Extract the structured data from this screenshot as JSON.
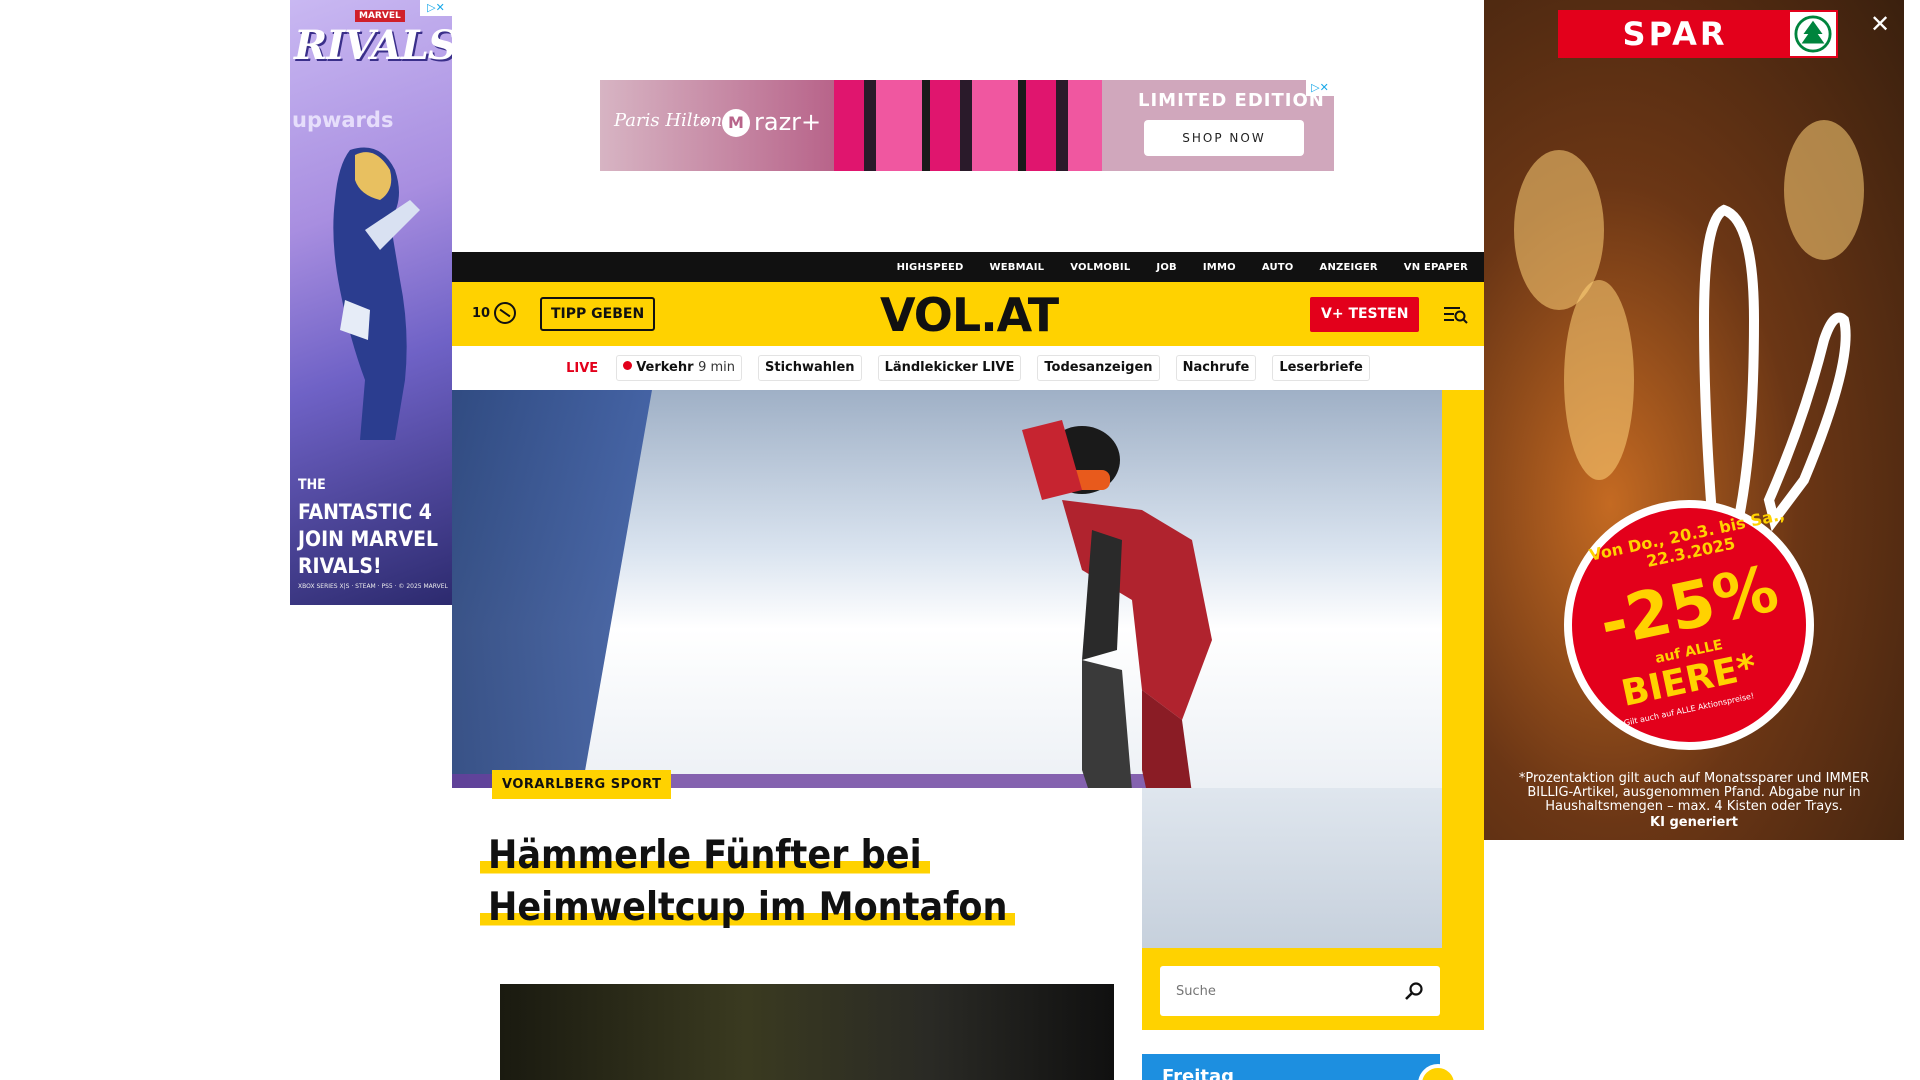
{
  "ads": {
    "left": {
      "brand": "MARVEL",
      "title": "RIVALS",
      "tag": "upwards",
      "caption_the": "THE",
      "caption_main": "FANTASTIC 4 JOIN MARVEL RIVALS!",
      "platforms": "XBOX SERIES X|S · STEAM · PS5 · © 2025 MARVEL"
    },
    "top": {
      "brand": "Paris Hilton",
      "x": "×",
      "product": "razr+",
      "headline": "LIMITED EDITION",
      "cta": "SHOP NOW"
    },
    "right": {
      "brand": "SPAR",
      "dates": "Von Do., 20.3. bis Sa., 22.3.2025",
      "discount": "-25%",
      "auf": "auf ALLE",
      "product": "BIERE*",
      "note": "Gilt auch auf ALLE Aktionspreise!",
      "fineprint": "*Prozentaktion gilt auch auf Monatssparer und IMMER BILLIG-Artikel, ausgenommen Pfand. Abgabe nur in Haushaltsmengen – max. 4 Kisten oder Trays.",
      "ki": "KI generiert",
      "close": "✕"
    }
  },
  "site": {
    "topbar": [
      "HIGHSPEED",
      "WEBMAIL",
      "VOLMOBIL",
      "JOB",
      "IMMO",
      "AUTO",
      "ANZEIGER",
      "VN EPAPER"
    ],
    "weather_temp": "10",
    "tipp_label": "TIPP GEBEN",
    "logo": "VOL.AT",
    "vplus_label": "V+ TESTEN",
    "live_label": "LIVE",
    "live_item": "Verkehr",
    "live_minutes": "9 min",
    "quicknav": [
      "Stichwahlen",
      "Ländlekicker LIVE",
      "Todesanzeigen",
      "Nachrufe",
      "Leserbriefe"
    ],
    "article": {
      "category": "VORARLBERG SPORT",
      "headline_line1": "Hämmerle Fünfter bei",
      "headline_line2": "Heimweltcup im Montafon"
    },
    "search_placeholder": "Suche",
    "weekday": "Freitag"
  },
  "colors": {
    "brand_yellow": "#ffd200",
    "live_red": "#e3001b",
    "topbar_black": "#111111",
    "weather_blue": "#1d8fe0"
  }
}
